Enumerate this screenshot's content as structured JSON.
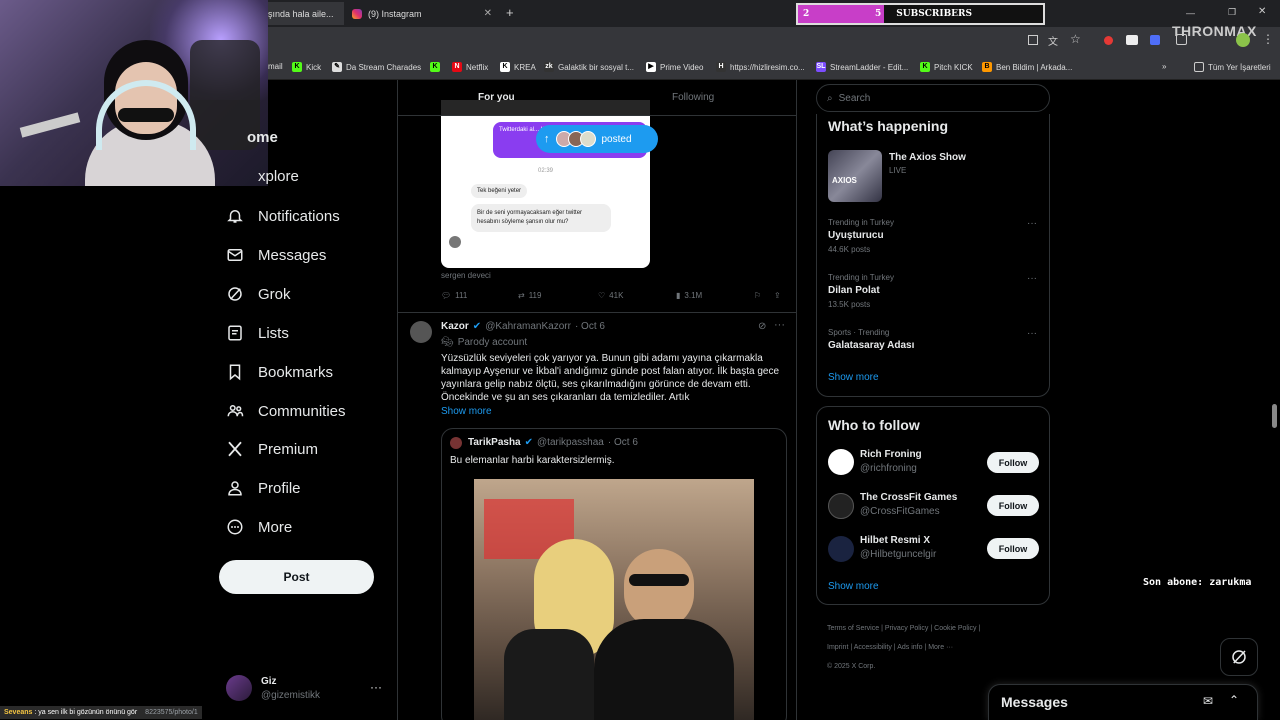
{
  "browser": {
    "tabs": [
      {
        "label": "şında hala aile..."
      },
      {
        "label": "(9) Instagram"
      }
    ],
    "new_tab": "+",
    "bookmarks": [
      {
        "label": "mail"
      },
      {
        "label": "Kick"
      },
      {
        "label": "Da Stream Charades"
      },
      {
        "label": "Netflix"
      },
      {
        "label": "KREA"
      },
      {
        "label": "Galaktik bir sosyal t..."
      },
      {
        "label": "Prime Video"
      },
      {
        "label": "https://hizliresim.co..."
      },
      {
        "label": "StreamLadder - Edit..."
      },
      {
        "label": "Pitch KICK"
      },
      {
        "label": "Ben Bildim | Arkada..."
      },
      {
        "label": "Tüm Yer İşaretleri"
      }
    ]
  },
  "overlay": {
    "sub_left": "2",
    "sub_label": "SUBSCRIBERS",
    "sub_right": "5",
    "sub_progress": 0.35,
    "brand": "THRONMAX",
    "last_sub": "Son abone: zarukma",
    "chat_user": "Seveans",
    "chat_msg": ": ya sen ilk bi gözünün önünü gör",
    "status_url": "8223575/photo/1"
  },
  "sidebar": {
    "items": [
      {
        "label": "Home",
        "visible": "ome"
      },
      {
        "label": "Explore",
        "visible": "xplore"
      },
      {
        "label": "Notifications"
      },
      {
        "label": "Messages"
      },
      {
        "label": "Grok"
      },
      {
        "label": "Lists"
      },
      {
        "label": "Bookmarks"
      },
      {
        "label": "Communities"
      },
      {
        "label": "Premium"
      },
      {
        "label": "Profile"
      },
      {
        "label": "More"
      }
    ],
    "post_label": "Post",
    "account_name": "Giz",
    "account_handle": "@gizemistikk"
  },
  "feed": {
    "tab_for_you": "For you",
    "tab_following": "Following",
    "posted_pill": "posted",
    "chat_top": "Twitterdaki al... Kaç beğeni... bilet hediye...",
    "chat_time": "02:39",
    "chat_msg1": "Tek beğeni yeter",
    "chat_msg2": "Bir de seni yormayacaksam eğer twitter hesabını söyleme şansın olur mu?",
    "post1_author_caption": "sergen deveci",
    "post1_stats": {
      "replies": "111",
      "reposts": "119",
      "likes": "41K",
      "views": "3.1M"
    },
    "post2": {
      "name": "Kazor",
      "handle": "@KahramanKazorr",
      "date": "· Oct 6",
      "badge": "Parody account",
      "text": "Yüzsüzlük seviyeleri çok yarıyor ya. Bunun gibi adamı yayına çıkarmakla kalmayıp Ayşenur ve İkbal'i andığımız günde post falan atıyor. İlk başta gece yayınlara gelip nabız ölçtü, ses çıkarılmadığını görünce de devam etti. Öncekinde ve şu an ses çıkaranları da temizlediler. Artık",
      "show_more": "Show more"
    },
    "quote": {
      "name": "TarikPasha",
      "handle": "@tarikpasshaa",
      "date": "· Oct 6",
      "text": "Bu elemanlar harbi karaktersizlermiş."
    }
  },
  "right": {
    "search_placeholder": "Search",
    "happening_title": "What’s happening",
    "event_title": "The Axios Show",
    "event_status": "LIVE",
    "event_thumb_text": "AXIOS",
    "trends": [
      {
        "meta": "Trending in Turkey",
        "name": "Uyuşturucu",
        "count": "44.6K posts"
      },
      {
        "meta": "Trending in Turkey",
        "name": "Dilan Polat",
        "count": "13.5K posts"
      },
      {
        "meta": "Sports · Trending",
        "name": "Galatasaray Adası",
        "count": ""
      }
    ],
    "show_more": "Show more",
    "who_title": "Who to follow",
    "follow": [
      {
        "name": "Rich Froning",
        "handle": "@richfroning",
        "btn": "Follow"
      },
      {
        "name": "The CrossFit Games",
        "handle": "@CrossFitGames",
        "btn": "Follow"
      },
      {
        "name": "Hilbet Resmi X",
        "handle": "@Hilbetguncelgir",
        "btn": "Follow"
      }
    ],
    "show_more2": "Show more",
    "footer": [
      "Terms of Service",
      "Privacy Policy",
      "Cookie Policy",
      "Imprint",
      "Accessibility",
      "Ads info",
      "More ···",
      "© 2025 X Corp."
    ],
    "messages_label": "Messages"
  }
}
